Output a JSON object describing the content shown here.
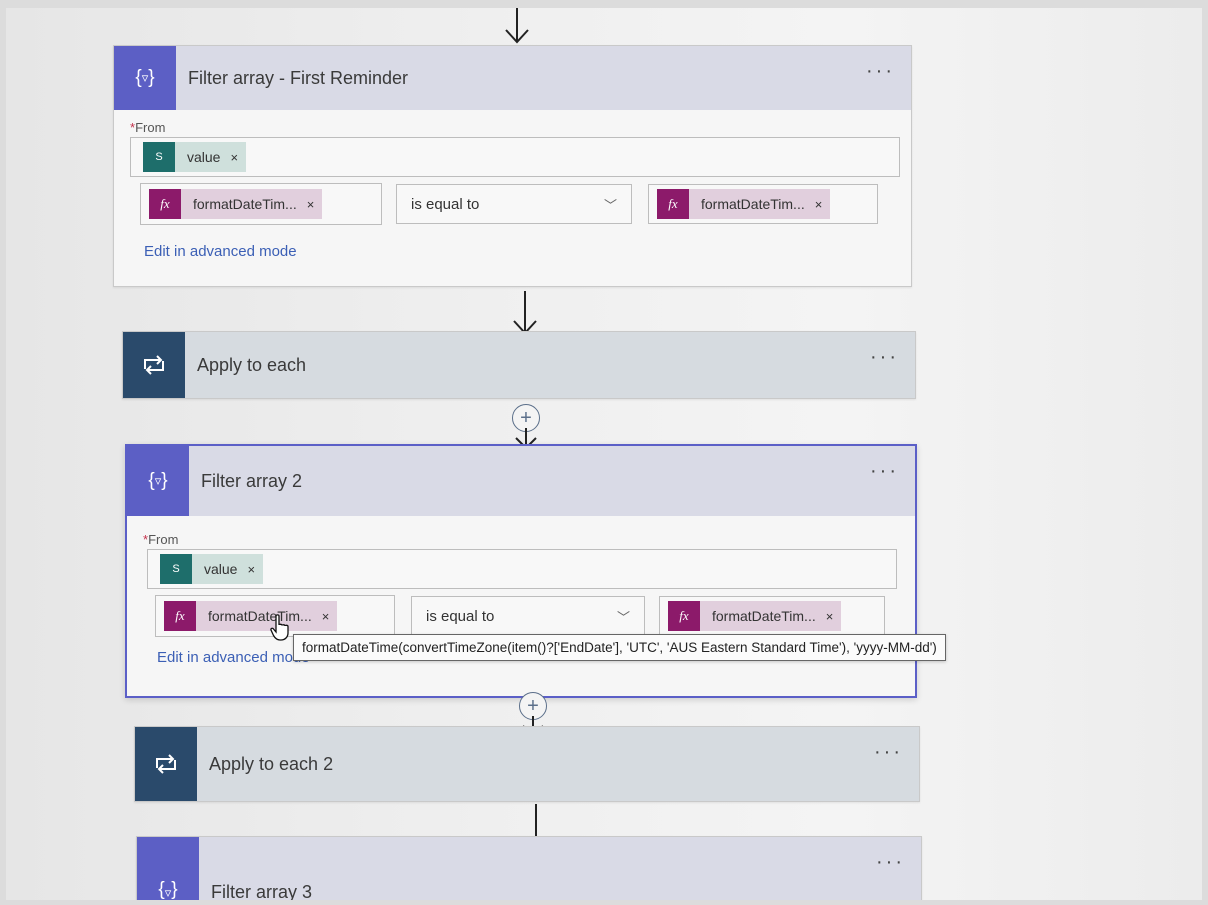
{
  "flow": {
    "filter_first": {
      "title": "Filter array - First Reminder",
      "more": "···",
      "from_label": "From",
      "from_token": "value",
      "left_token": "formatDateTim...",
      "operator": "is equal to",
      "right_token": "formatDateTim...",
      "advanced_link": "Edit in advanced mode",
      "token_close": "×"
    },
    "apply_each": {
      "title": "Apply to each",
      "more": "···"
    },
    "filter_2": {
      "title": "Filter array 2",
      "more": "···",
      "from_label": "From",
      "from_token": "value",
      "left_token": "formatDateTim...",
      "operator": "is equal to",
      "right_token": "formatDateTim...",
      "advanced_link": "Edit in advanced mode",
      "token_close": "×"
    },
    "apply_each_2": {
      "title": "Apply to each 2",
      "more": "···"
    },
    "filter_3": {
      "title": "Filter array 3",
      "more": "···"
    }
  },
  "tooltip": {
    "text": "formatDateTime(convertTimeZone(item()?['EndDate'], 'UTC', 'AUS Eastern Standard Time'), 'yyyy-MM-dd')"
  },
  "icons": {
    "filter": "filter-array-icon",
    "loop": "loop-icon",
    "sharepoint": "sharepoint-icon",
    "fx": "function-icon",
    "add": "add-step-icon"
  },
  "colors": {
    "filter_accent": "#5c5fc5",
    "loop_accent": "#2a4a6b",
    "fx_accent": "#8c1a6a",
    "sharepoint_accent": "#1e6e6b",
    "link": "#3b5fb5"
  }
}
